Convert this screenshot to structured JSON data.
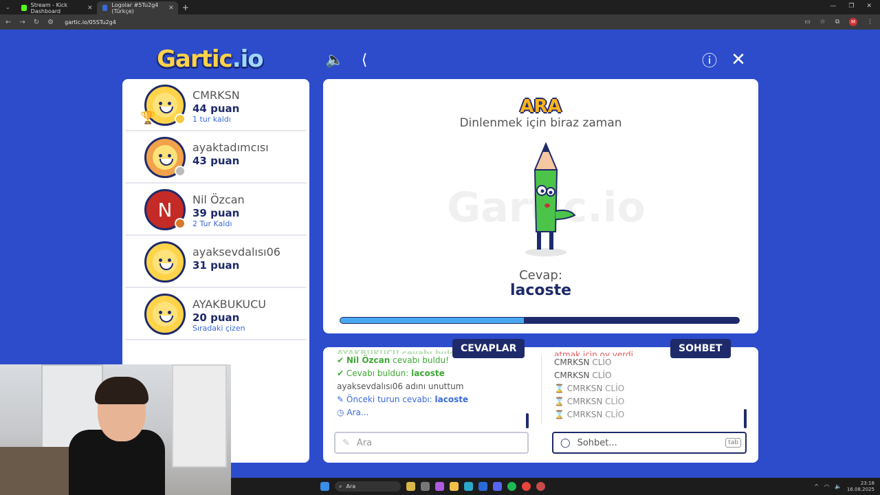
{
  "browser": {
    "tabs": [
      {
        "title": "Stream - Kick Dashboard",
        "icon_color": "#53fc18"
      },
      {
        "title": "Logolar #5Tu2g4 (Türkçe)",
        "icon_color": "#3a6ad8"
      }
    ],
    "url": "gartic.io/05STu2g4",
    "profile": "M"
  },
  "game": {
    "logo_main": "Gartic",
    "logo_tail": ".io",
    "players": [
      {
        "name": "CMRKSN",
        "points": "44 puan",
        "note": "1 tur kaldı",
        "dot": "#f5c842",
        "trophy": true,
        "avatar": "face"
      },
      {
        "name": "ayaktadımcısı",
        "points": "43 puan",
        "note": "",
        "dot": "#bbbbbb",
        "avatar": "orange"
      },
      {
        "name": "Nil Özcan",
        "points": "39 puan",
        "note": "2 Tur Kaldı",
        "dot": "#d8782a",
        "avatar": "N"
      },
      {
        "name": "ayaksevdalısı06",
        "points": "31 puan",
        "note": "",
        "avatar": "face"
      },
      {
        "name": "AYAKBUKUCU",
        "points": "20 puan",
        "note": "Sıradaki çizen",
        "avatar": "face"
      }
    ],
    "board": {
      "title": "ARA",
      "subtitle": "Dinlenmek için biraz zaman",
      "watermark": "Gartic.io",
      "answer_label": "Cevap:",
      "answer_value": "lacoste",
      "progress": 0.46
    },
    "answers": {
      "tab_label": "CEVAPLAR",
      "lines": {
        "l0": "AYAKBUKUCU cevabı buldu!",
        "l1_name": "Nil Özcan",
        "l1_rest": "cevabı buldu!",
        "l2_pre": "Cevabı buldun:",
        "l2_word": "lacoste",
        "l3": "ayaksevdalısı06 adını unuttum",
        "l4_pre": "Önceki turun cevabı:",
        "l4_word": "lacoste",
        "l5": "Ara..."
      },
      "input_placeholder": "Ara"
    },
    "chat": {
      "tab_label": "SOHBET",
      "lines": {
        "c0": "atmak için oy verdi",
        "c1_name": "CMRKSN",
        "c1_msg": "CLİO",
        "c2_name": "CMRKSN",
        "c2_msg": "CLİO",
        "c3_name": "CMRKSN",
        "c3_msg": "CLİO",
        "c4_name": "CMRKSN",
        "c4_msg": "CLİO",
        "c5_name": "CMRKSN",
        "c5_msg": "CLİO"
      },
      "input_placeholder": "Sohbet...",
      "tab_key": "tab"
    }
  },
  "taskbar": {
    "search_text": "Ara",
    "time": "23:18",
    "date": "16.08.2025"
  }
}
